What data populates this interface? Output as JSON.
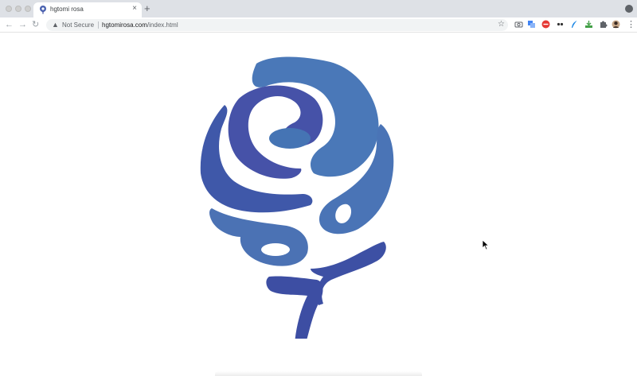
{
  "browser": {
    "tab": {
      "title": "hgtomi rosa",
      "favicon": "rose-favicon-icon",
      "close": "×"
    },
    "new_tab": "+",
    "toolbar": {
      "back": "←",
      "forward": "→",
      "reload": "↻",
      "security_label": "Not Secure",
      "url_host": "hgtomirosa.com",
      "url_path": "/index.html",
      "bookmark_icon": "☆",
      "menu_icon": "⋮"
    },
    "extensions": [
      "camera-icon",
      "translate-icon",
      "adblock-icon",
      "dots-icon",
      "feather-icon",
      "download-icon",
      "puzzle-icon",
      "avatar"
    ]
  },
  "page": {
    "logo": "blue-rose-logo",
    "colors": {
      "rose_light": "#4a72b5",
      "rose_dark": "#3f4ea2"
    }
  }
}
